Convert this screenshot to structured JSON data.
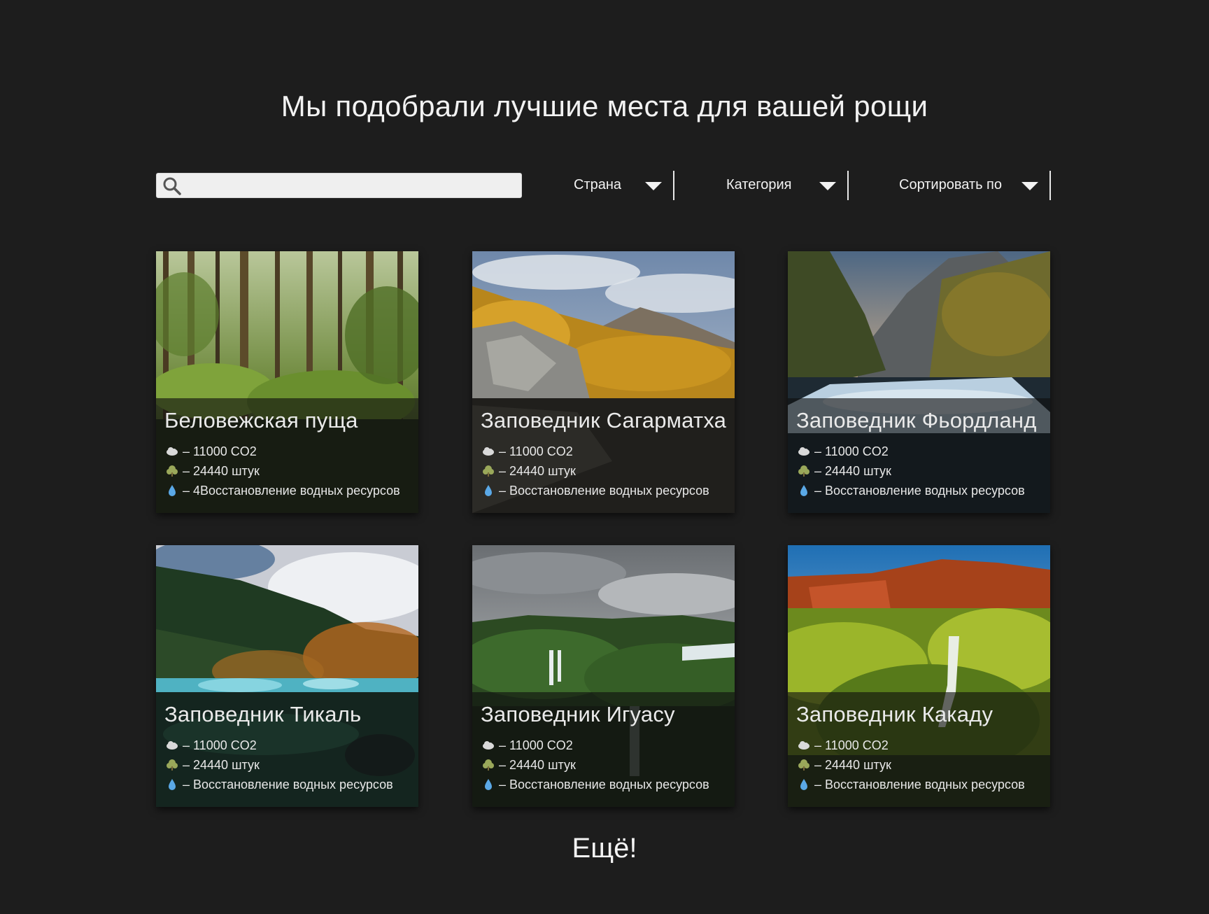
{
  "header": {
    "title": "Мы подобрали лучшие места для вашей рощи"
  },
  "search": {
    "value": "",
    "placeholder": ""
  },
  "filters": [
    {
      "label": "Страна"
    },
    {
      "label": "Категория"
    },
    {
      "label": "Сортировать по"
    }
  ],
  "icons": {
    "search": "search-icon",
    "caret": "chevron-down-icon",
    "co2": "cloud-icon",
    "trees": "tree-icon",
    "water": "water-drop-icon"
  },
  "colors": {
    "background": "#1d1d1d",
    "text": "#ffffff",
    "water_icon": "#5aa8e6",
    "tree_icon": "#9aa85a",
    "cloud_icon": "#d9d9d9"
  },
  "cards": [
    {
      "name": "Беловежская пуща",
      "co2": "– 11000 CO2",
      "trees": "– 24440 штук",
      "water": "– 4Восстановление водных ресурсов"
    },
    {
      "name": "Заповедник Сагарматха",
      "co2": "– 11000 CO2",
      "trees": "– 24440 штук",
      "water": "– Восстановление водных ресурсов"
    },
    {
      "name": "Заповедник Фьордланд",
      "co2": "– 11000 CO2",
      "trees": "– 24440 штук",
      "water": "– Восстановление водных ресурсов"
    },
    {
      "name": "Заповедник Тикаль",
      "co2": "– 11000 CO2",
      "trees": "– 24440 штук",
      "water": "– Восстановление водных ресурсов"
    },
    {
      "name": "Заповедник Игуасу",
      "co2": "– 11000 CO2",
      "trees": "– 24440 штук",
      "water": "– Восстановление водных ресурсов"
    },
    {
      "name": "Заповедник Какаду",
      "co2": "– 11000 CO2",
      "trees": "– 24440 штук",
      "water": "– Восстановление водных ресурсов"
    }
  ],
  "more_button": {
    "label": "Ещё!"
  }
}
